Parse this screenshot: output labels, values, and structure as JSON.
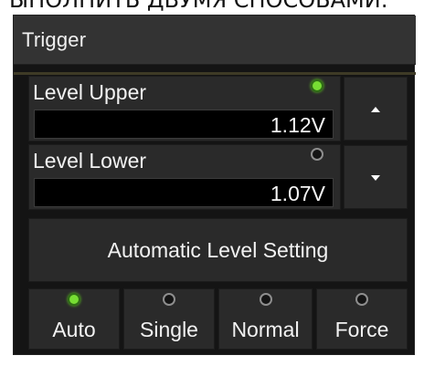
{
  "header_text": "ЫПОЛНИТЬ ДВУМЯ СПОСОБАМИ:",
  "panel": {
    "title": "Trigger"
  },
  "levels": {
    "upper": {
      "label": "Level Upper",
      "value": "1.12V",
      "indicator": "on"
    },
    "lower": {
      "label": "Level Lower",
      "value": "1.07V",
      "indicator": "off"
    }
  },
  "automatic_button": {
    "label": "Automatic Level Setting"
  },
  "modes": [
    {
      "label": "Auto",
      "indicator": "on"
    },
    {
      "label": "Single",
      "indicator": "off"
    },
    {
      "label": "Normal",
      "indicator": "off"
    },
    {
      "label": "Force",
      "indicator": "off"
    }
  ],
  "icons": {
    "up": "triangle-up-icon",
    "down": "triangle-down-icon"
  },
  "colors": {
    "panel_bg": "#141414",
    "button_bg": "#2a2a2a",
    "header_bg": "#333333",
    "indicator_on": "#77dd33",
    "indicator_off_ring": "#8e8e8e",
    "text": "#f2f2f2"
  }
}
